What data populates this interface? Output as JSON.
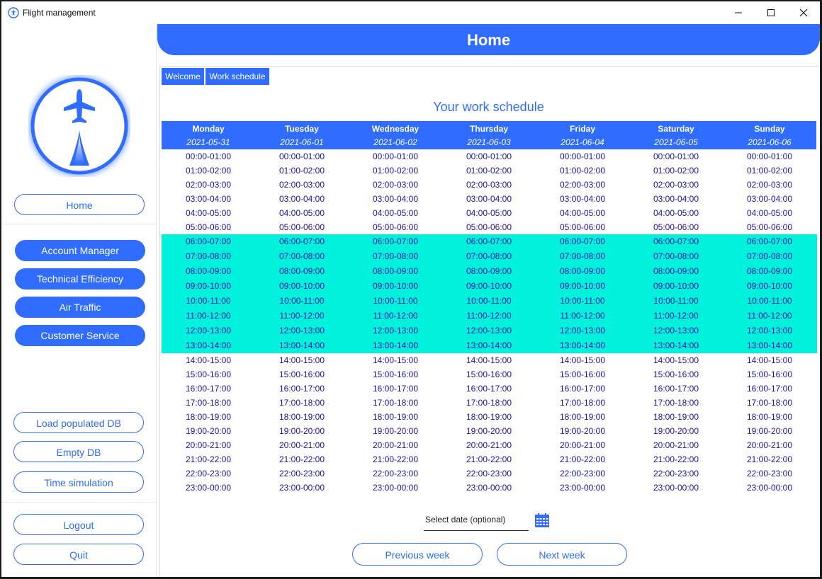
{
  "window": {
    "title": "Flight management"
  },
  "sidebar": {
    "home_label": "Home",
    "nav": [
      {
        "label": "Account Manager"
      },
      {
        "label": "Technical Efficiency"
      },
      {
        "label": "Air Traffic"
      },
      {
        "label": "Customer Service"
      }
    ],
    "db": [
      {
        "label": "Load populated DB"
      },
      {
        "label": "Empty DB"
      },
      {
        "label": "Time simulation"
      }
    ],
    "logout_label": "Logout",
    "quit_label": "Quit"
  },
  "header": {
    "title": "Home"
  },
  "tabs": [
    {
      "label": "Welcome"
    },
    {
      "label": "Work schedule"
    }
  ],
  "schedule": {
    "title": "Your work schedule",
    "days": [
      {
        "name": "Monday",
        "date": "2021-05-31"
      },
      {
        "name": "Tuesday",
        "date": "2021-06-01"
      },
      {
        "name": "Wednesday",
        "date": "2021-06-02"
      },
      {
        "name": "Thursday",
        "date": "2021-06-03"
      },
      {
        "name": "Friday",
        "date": "2021-06-04"
      },
      {
        "name": "Saturday",
        "date": "2021-06-05"
      },
      {
        "name": "Sunday",
        "date": "2021-06-06"
      }
    ],
    "slots": [
      "00:00-01:00",
      "01:00-02:00",
      "02:00-03:00",
      "03:00-04:00",
      "04:00-05:00",
      "05:00-06:00",
      "06:00-07:00",
      "07:00-08:00",
      "08:00-09:00",
      "09:00-10:00",
      "10:00-11:00",
      "11:00-12:00",
      "12:00-13:00",
      "13:00-14:00",
      "14:00-15:00",
      "15:00-16:00",
      "16:00-17:00",
      "17:00-18:00",
      "18:00-19:00",
      "19:00-20:00",
      "20:00-21:00",
      "21:00-22:00",
      "22:00-23:00",
      "23:00-00:00"
    ],
    "highlighted_slots": [
      "06:00-07:00",
      "07:00-08:00",
      "08:00-09:00",
      "09:00-10:00",
      "10:00-11:00",
      "11:00-12:00",
      "12:00-13:00",
      "13:00-14:00"
    ],
    "highlight_color": "#00f2dc"
  },
  "date_picker": {
    "placeholder": "Select date (optional)"
  },
  "nav_buttons": {
    "prev_label": "Previous week",
    "next_label": "Next week"
  },
  "colors": {
    "accent": "#2f6cff",
    "slot_text": "#1a12a8"
  }
}
